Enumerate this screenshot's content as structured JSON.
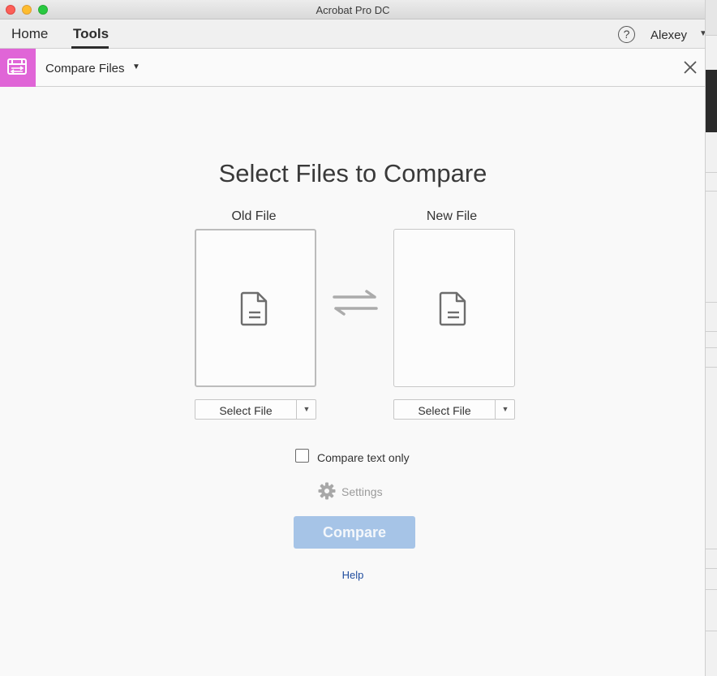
{
  "window": {
    "title": "Acrobat Pro DC"
  },
  "nav": {
    "tabs": [
      {
        "label": "Home",
        "active": false
      },
      {
        "label": "Tools",
        "active": true
      }
    ],
    "help_icon": "question-circle-icon",
    "help_glyph": "?",
    "user_name": "Alexey"
  },
  "tool_header": {
    "tool_name": "Compare Files",
    "icon": "compare-files-icon",
    "accent_color": "#e065d7",
    "close_icon": "close-icon"
  },
  "main": {
    "heading": "Select Files to Compare",
    "old_file": {
      "label": "Old File",
      "select_label": "Select File"
    },
    "new_file": {
      "label": "New File",
      "select_label": "Select File"
    },
    "compare_text_only": {
      "label": "Compare text only",
      "checked": false
    },
    "settings_label": "Settings",
    "compare_button": "Compare",
    "help_link": "Help"
  },
  "colors": {
    "compare_button": "#a6c4e7",
    "help_link": "#1f4c9e"
  }
}
